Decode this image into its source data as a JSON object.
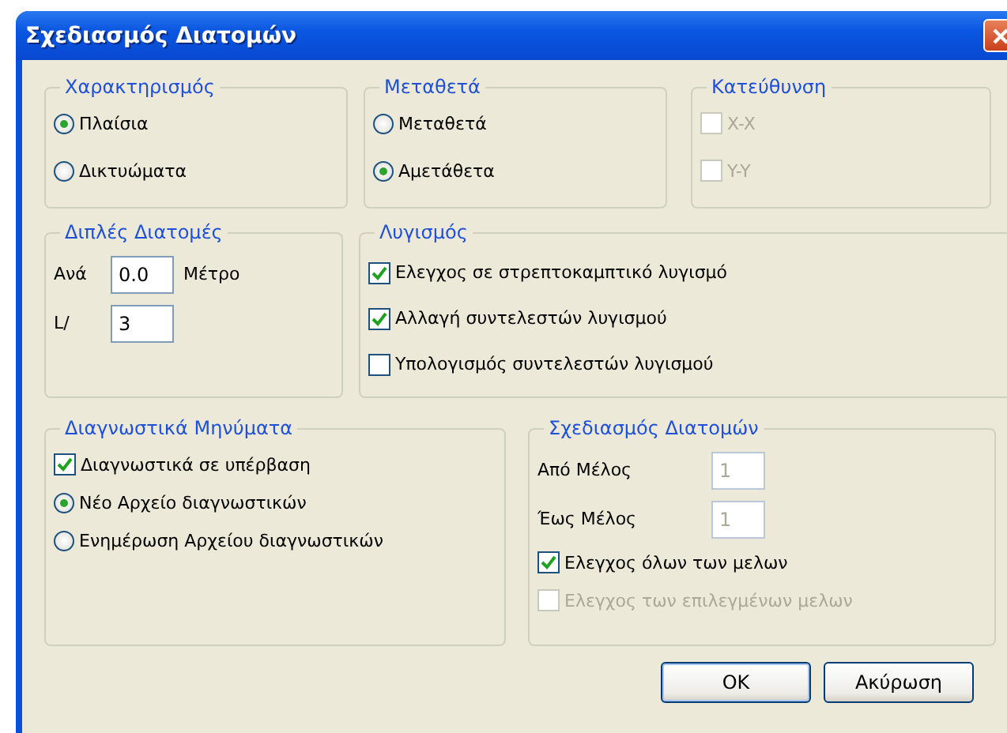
{
  "window": {
    "title": "Σχεδιασμός Διατομών"
  },
  "rows": [
    [
      {
        "title": "Χαρακτηρισμός",
        "items": [
          {
            "kind": "radio",
            "label": "Πλαίσια",
            "selected": true
          },
          {
            "kind": "radio",
            "label": "Δικτυώματα",
            "selected": false
          }
        ]
      },
      {
        "title": "Μεταθετά",
        "items": [
          {
            "kind": "radio",
            "label": "Μεταθετά",
            "selected": false
          },
          {
            "kind": "radio",
            "label": "Αμετάθετα",
            "selected": true
          }
        ]
      },
      {
        "title": "Κατεύθυνση",
        "items": [
          {
            "kind": "checkbox",
            "label": "X-X",
            "checked": false,
            "disabled": true
          },
          {
            "kind": "checkbox",
            "label": "Y-Y",
            "checked": false,
            "disabled": true
          }
        ]
      }
    ],
    [
      {
        "title": "Διπλές Διατομές",
        "items": [
          {
            "kind": "field",
            "label": "Ανά",
            "value": "0.0",
            "unit": "Μέτρο",
            "disabled": false
          },
          {
            "kind": "field",
            "label": "L/",
            "value": "3",
            "disabled": false
          }
        ]
      },
      {
        "title": "Λυγισμός",
        "items": [
          {
            "kind": "checkbox",
            "label": "Ελεγχος σε στρεπτοκαμπτικό λυγισμό",
            "checked": true,
            "disabled": false
          },
          {
            "kind": "checkbox",
            "label": "Αλλαγή συντελεστών λυγισμού",
            "checked": true,
            "disabled": false
          },
          {
            "kind": "checkbox",
            "label": "Υπολογισμός συντελεστών λυγισμού",
            "checked": false,
            "disabled": false
          }
        ]
      }
    ],
    [
      {
        "title": "Διαγνωστικά Μηνύματα",
        "items": [
          {
            "kind": "checkbox",
            "label": "Διαγνωστικά σε υπέρβαση",
            "checked": true,
            "disabled": false
          },
          {
            "kind": "radio",
            "label": "Νέο Αρχείο διαγνωστικών",
            "selected": true
          },
          {
            "kind": "radio",
            "label": "Ενημέρωση Αρχείου διαγνωστικών",
            "selected": false
          }
        ]
      },
      {
        "title": "Σχεδιασμός Διατομών",
        "items": [
          {
            "kind": "field",
            "label": "Από Μέλος",
            "value": "1",
            "disabled": true
          },
          {
            "kind": "field",
            "label": "Έως Μέλος",
            "value": "1",
            "disabled": true
          },
          {
            "kind": "checkbox",
            "label": "Ελεγχος όλων των μελων",
            "checked": true,
            "disabled": false
          },
          {
            "kind": "checkbox",
            "label": "Ελεγχος των επιλεγμένων μελων",
            "checked": false,
            "disabled": true
          }
        ]
      }
    ]
  ],
  "buttons": [
    {
      "label": "OK",
      "default": true
    },
    {
      "label": "Ακύρωση",
      "default": false
    }
  ]
}
